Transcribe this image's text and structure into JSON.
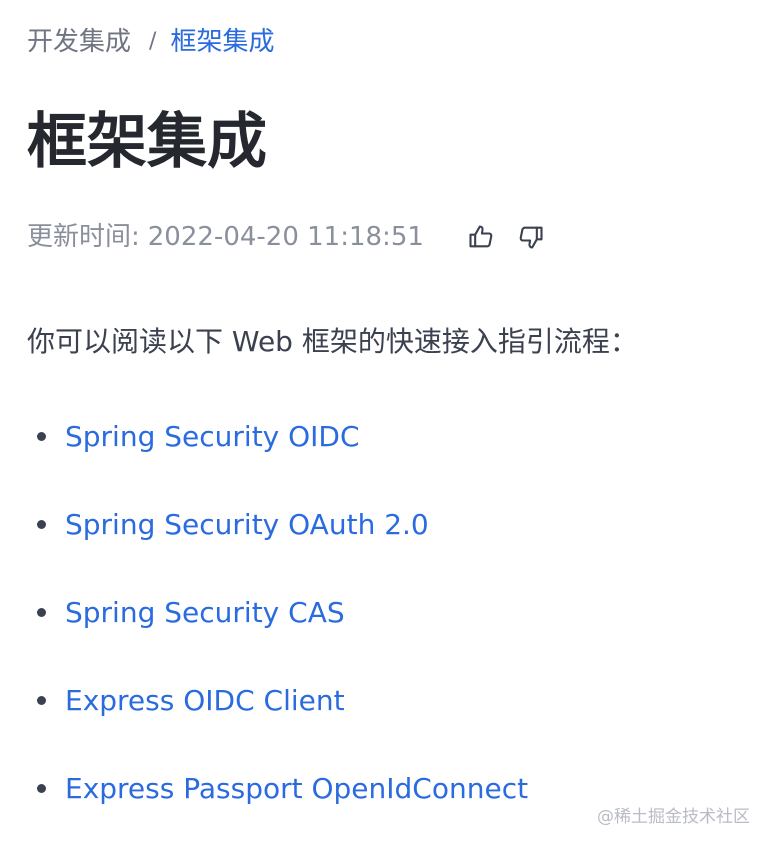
{
  "breadcrumb": {
    "parent": "开发集成",
    "separator": "/",
    "current": "框架集成"
  },
  "page": {
    "title": "框架集成"
  },
  "meta": {
    "update_label": "更新时间:",
    "update_time": "2022-04-20 11:18:51",
    "icons": [
      "thumbs-up-icon",
      "thumbs-down-icon"
    ]
  },
  "content": {
    "intro": "你可以阅读以下 Web 框架的快速接入指引流程：",
    "links": [
      {
        "label": "Spring Security OIDC"
      },
      {
        "label": "Spring Security OAuth 2.0"
      },
      {
        "label": "Spring Security CAS"
      },
      {
        "label": "Express OIDC Client"
      },
      {
        "label": "Express Passport OpenIdConnect"
      }
    ]
  },
  "watermark": "@稀土掘金技术社区",
  "colors": {
    "link": "#2b6be0",
    "title": "#25282f",
    "body_text": "#3c4150",
    "muted": "#8a8f9c"
  }
}
